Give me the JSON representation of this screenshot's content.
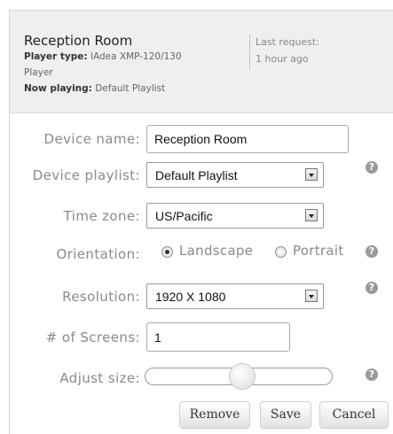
{
  "device": {
    "title": "Reception Room",
    "player_type_label": "Player type:",
    "player_type_value": "IAdea XMP-120/130",
    "player_type_cont": "Player",
    "now_playing_label": "Now playing:",
    "now_playing_value": "Default Playlist",
    "last_request_label": "Last request:",
    "last_request_value": "1 hour ago"
  },
  "form": {
    "device_name_label": "Device name:",
    "device_name_value": "Reception Room",
    "device_playlist_label": "Device playlist:",
    "device_playlist_value": "Default Playlist",
    "time_zone_label": "Time zone:",
    "time_zone_value": "US/Pacific",
    "orientation_label": "Orientation:",
    "orientation_options": [
      "Landscape",
      "Portrait"
    ],
    "orientation_selected": "Landscape",
    "resolution_label": "Resolution:",
    "resolution_value": "1920 X 1080",
    "screens_label": "# of Screens:",
    "screens_value": "1",
    "adjust_size_label": "Adjust size:",
    "adjust_size_level": 0.5
  },
  "help_glyph": "?",
  "actions": {
    "remove": "Remove",
    "save": "Save",
    "cancel": "Cancel"
  }
}
